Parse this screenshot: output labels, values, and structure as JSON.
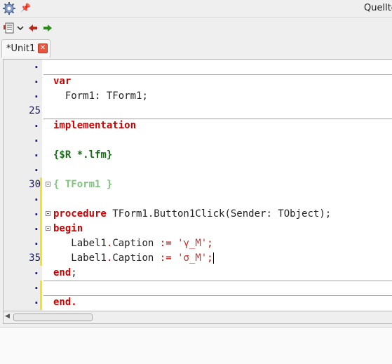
{
  "window": {
    "title": "Quellte",
    "app_icon": "gear-icon",
    "pin_icon": "pin-icon"
  },
  "toolbar": {
    "items": [
      {
        "name": "view-list-button",
        "icon": "list-icon"
      },
      {
        "name": "dropdown-button",
        "icon": "chevron-down-icon"
      },
      {
        "name": "back-button",
        "icon": "arrow-left-icon",
        "color": "#b22a1c"
      },
      {
        "name": "forward-button",
        "icon": "arrow-right-icon",
        "color": "#2a8a1c"
      }
    ]
  },
  "tabs": [
    {
      "label": "*Unit1",
      "close_icon": "close-icon",
      "close_symbol": "✕"
    }
  ],
  "editor": {
    "colors": {
      "keyword": "#cc0000",
      "directive": "#1a6b1a",
      "comment": "#7ec47e",
      "string": "#cc3333",
      "line_number": "#1a1a6e",
      "modified_marker": "#f2e51c"
    },
    "lines": [
      {
        "num": ".",
        "code": ""
      },
      {
        "num": ".",
        "code": "var"
      },
      {
        "num": ".",
        "code": "  Form1: TForm1;"
      },
      {
        "num": "25",
        "code": ""
      },
      {
        "num": ".",
        "code": "implementation"
      },
      {
        "num": ".",
        "code": ""
      },
      {
        "num": ".",
        "code": "{$R *.lfm}"
      },
      {
        "num": ".",
        "code": ""
      },
      {
        "num": "30",
        "code": "{ TForm1 }"
      },
      {
        "num": ".",
        "code": ""
      },
      {
        "num": ".",
        "code": "procedure TForm1.Button1Click(Sender: TObject);"
      },
      {
        "num": ".",
        "code": "begin"
      },
      {
        "num": ".",
        "code": "   Label1.Caption := 'γ_M';"
      },
      {
        "num": "35",
        "code": "   Label1.Caption := 'σ_M';"
      },
      {
        "num": ".",
        "code": "end;"
      },
      {
        "num": ".",
        "code": ""
      },
      {
        "num": ".",
        "code": "end."
      }
    ],
    "tokens": {
      "var": "var",
      "form1_decl_name": "Form1",
      "form1_decl_rest": ": TForm1;",
      "implementation": "implementation",
      "directive": "{$R *.lfm}",
      "comment": "{ TForm1 }",
      "procedure": "procedure",
      "proc_sig_pre": " TForm1.Button1Click",
      "proc_sig_paren": "(",
      "proc_sig_param": "Sender: TObject",
      "proc_sig_end": ");",
      "begin": "begin",
      "label_obj": "Label1",
      "label_dot": ".",
      "label_prop": "Caption",
      "assign": ":=",
      "str1": "'γ_M'",
      "str2": "'σ_M'",
      "semi": ";",
      "end_semi": "end",
      "end_dot": "end."
    }
  },
  "scrollbar": {
    "type": "horizontal"
  }
}
